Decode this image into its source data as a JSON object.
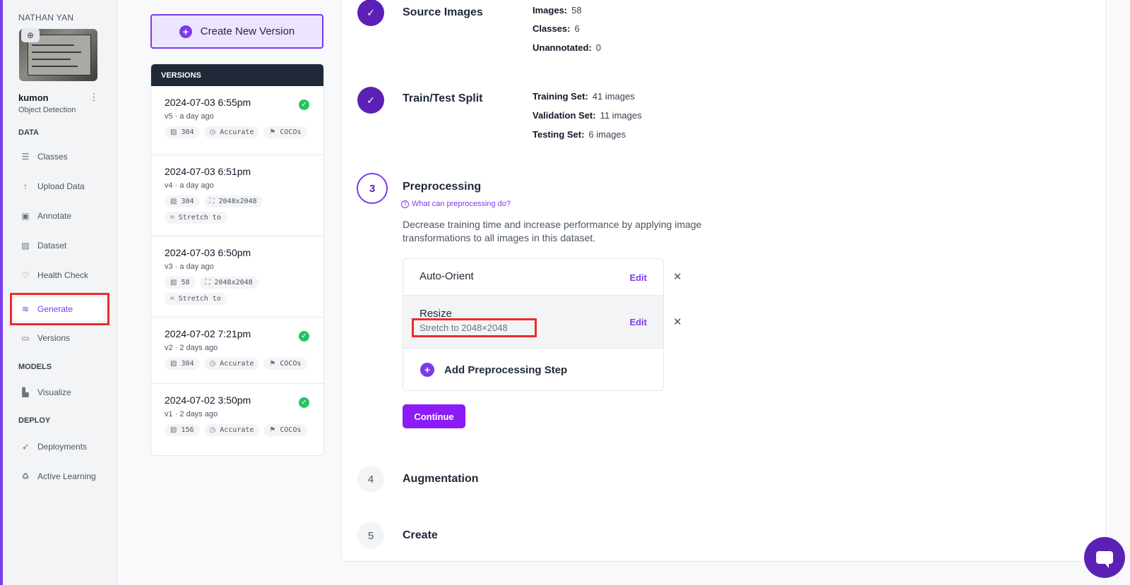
{
  "sidebar": {
    "workspace": "NATHAN YAN",
    "project_name": "kumon",
    "project_type": "Object Detection",
    "sections": {
      "data": "DATA",
      "models": "MODELS",
      "deploy": "DEPLOY"
    },
    "items": [
      {
        "label": "Classes",
        "icon": "list-icon"
      },
      {
        "label": "Upload Data",
        "icon": "upload-icon"
      },
      {
        "label": "Annotate",
        "icon": "annotate-icon"
      },
      {
        "label": "Dataset",
        "icon": "image-icon"
      },
      {
        "label": "Health Check",
        "icon": "heart-icon"
      },
      {
        "label": "Generate",
        "icon": "layers-icon",
        "active": true
      },
      {
        "label": "Versions",
        "icon": "folder-icon"
      },
      {
        "label": "Visualize",
        "icon": "chart-icon"
      },
      {
        "label": "Deployments",
        "icon": "rocket-icon"
      },
      {
        "label": "Active Learning",
        "icon": "recycle-icon"
      }
    ]
  },
  "create_button": "Create New Version",
  "versions": {
    "header": "VERSIONS",
    "list": [
      {
        "date": "2024-07-03 6:55pm",
        "sub": "v5 · a day ago",
        "tags": [
          "304",
          "Accurate",
          "COCOs"
        ],
        "check": true
      },
      {
        "date": "2024-07-03 6:51pm",
        "sub": "v4 · a day ago",
        "tags": [
          "304",
          "2048x2048",
          "Stretch to"
        ],
        "check": false
      },
      {
        "date": "2024-07-03 6:50pm",
        "sub": "v3 · a day ago",
        "tags": [
          "58",
          "2048x2048",
          "Stretch to"
        ],
        "check": false
      },
      {
        "date": "2024-07-02 7:21pm",
        "sub": "v2 · 2 days ago",
        "tags": [
          "304",
          "Accurate",
          "COCOs"
        ],
        "check": true
      },
      {
        "date": "2024-07-02 3:50pm",
        "sub": "v1 · 2 days ago",
        "tags": [
          "156",
          "Accurate",
          "COCOs"
        ],
        "check": true
      }
    ]
  },
  "steps": {
    "source": {
      "title": "Source Images",
      "images_label": "Images:",
      "images": "58",
      "classes_label": "Classes:",
      "classes": "6",
      "unannotated_label": "Unannotated:",
      "unannotated": "0"
    },
    "split": {
      "title": "Train/Test Split",
      "train_label": "Training Set:",
      "train": "41 images",
      "valid_label": "Validation Set:",
      "valid": "11 images",
      "test_label": "Testing Set:",
      "test": "6 images"
    },
    "preprocessing": {
      "number": "3",
      "title": "Preprocessing",
      "help": "What can preprocessing do?",
      "description": "Decrease training time and increase performance by applying image transformations to all images in this dataset.",
      "auto_orient": "Auto-Orient",
      "resize": "Resize",
      "resize_detail": "Stretch to 2048×2048",
      "edit": "Edit",
      "add_step": "Add Preprocessing Step",
      "continue": "Continue"
    },
    "augmentation": {
      "number": "4",
      "title": "Augmentation"
    },
    "create": {
      "number": "5",
      "title": "Create"
    }
  }
}
